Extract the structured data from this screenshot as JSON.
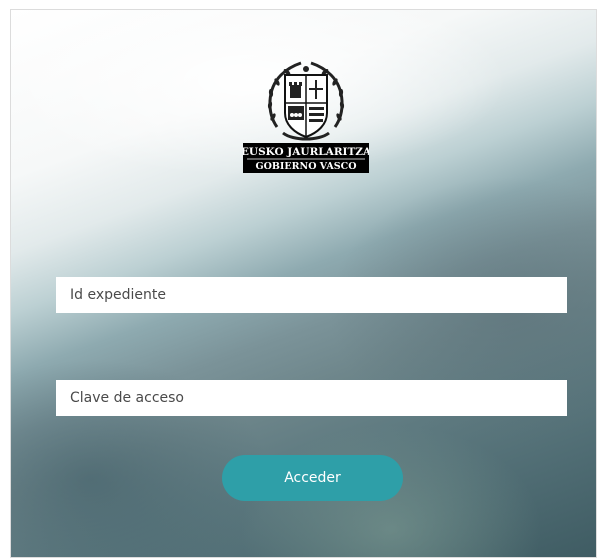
{
  "logo": {
    "name": "escudo-gobierno-vasco",
    "line1": "EUSKO JAURLARITZA",
    "line2": "GOBIERNO VASCO"
  },
  "form": {
    "id_expediente_placeholder": "Id expediente",
    "id_expediente_value": "",
    "clave_placeholder": "Clave de acceso",
    "clave_value": "",
    "submit_label": "Acceder"
  },
  "colors": {
    "button": "#2e9fa8",
    "button_text": "#ffffff",
    "logo_bar": "#000000"
  }
}
